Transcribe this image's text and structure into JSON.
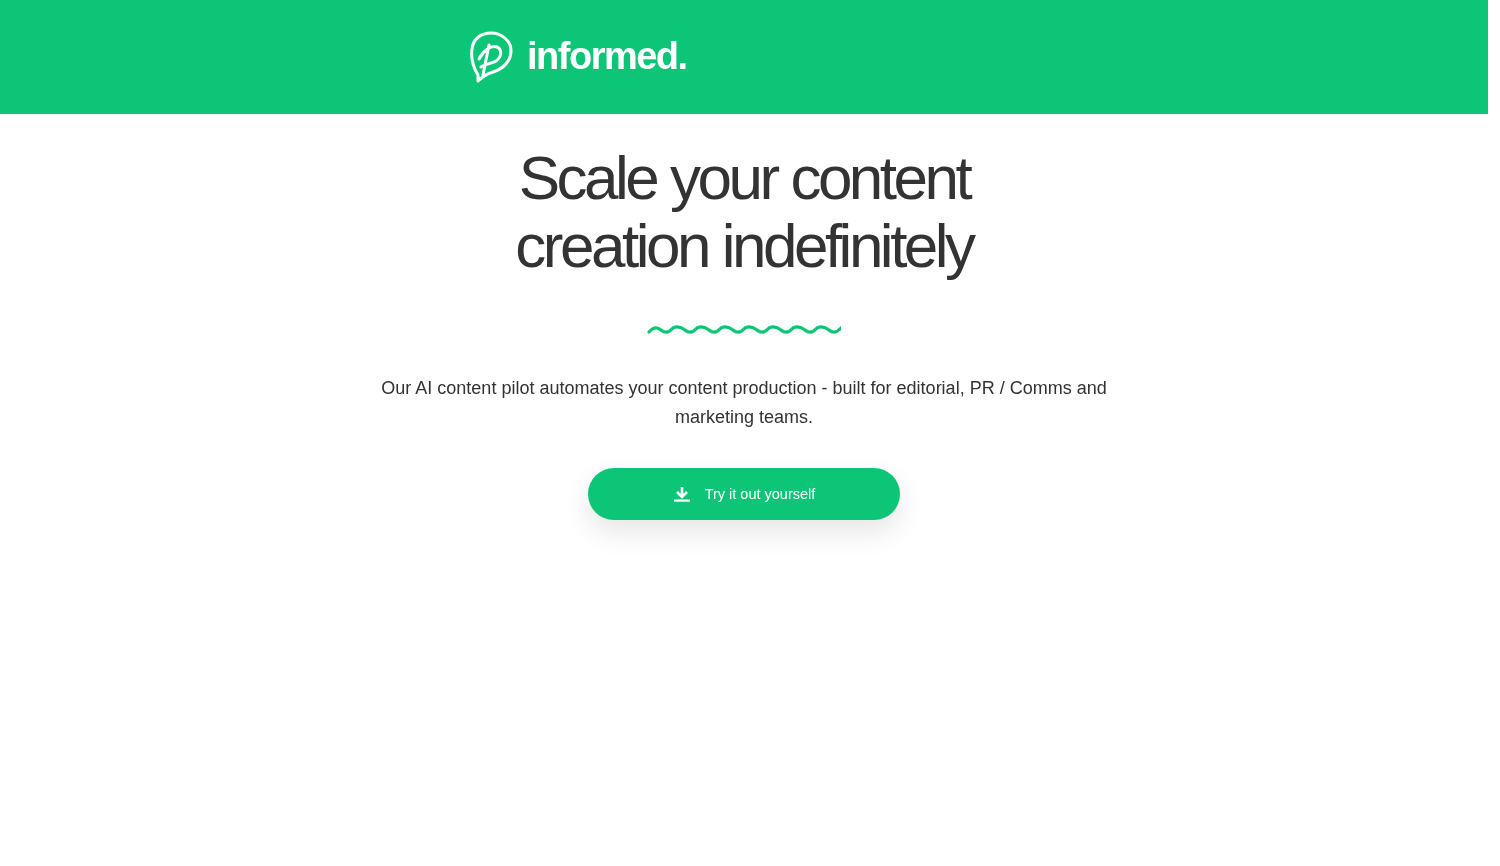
{
  "header": {
    "logo": {
      "wordmark": "informed."
    }
  },
  "hero": {
    "heading": "Scale your content creation indefinitely",
    "description": "Our AI content pilot automates your content production - built for editorial, PR / Comms and marketing teams.",
    "cta": {
      "label": "Try it out yourself"
    }
  }
}
